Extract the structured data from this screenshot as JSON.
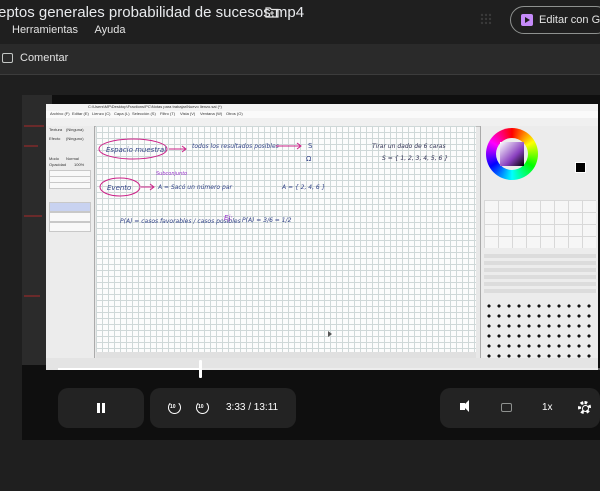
{
  "header": {
    "title": "eptos generales probabilidad de sucesos.mp4",
    "menu": [
      "Herramientas",
      "Ayuda"
    ],
    "edit_button": "Editar con Go"
  },
  "comment_bar": {
    "label": "Comentar"
  },
  "video": {
    "app_window_title": "C:\\Users\\MP\\Desktop\\Fractions\\PC\\Notas para trabajar\\Nuevo lienzo.sai (*)",
    "app_menu": [
      "Archivo (F)",
      "Editar (E)",
      "Lienzo (C)",
      "Capa (L)",
      "Selección (S)",
      "Filtro (T)",
      "Vista (V)",
      "Ventana (W)",
      "Otros (O)"
    ],
    "left_panel": {
      "labels": [
        "Textura",
        "Efecto",
        "Modo",
        "Opacidad"
      ],
      "values": [
        "(Ninguna)",
        "(Ninguno)",
        "Normal",
        "100%"
      ]
    },
    "whiteboard": {
      "line1_left": "Espacio muestral",
      "line1_mid": "todos los resultados posibles",
      "line1_s": "S",
      "line1_omega": "Ω",
      "line1_right": "Tirar un dado de 6 caras",
      "line1_set": "S = { 1, 2, 3, 4, 5, 6 }",
      "subset_note": "Subconjunto",
      "event": "Evento",
      "event_def": "A = Sacó un número par",
      "event_set": "A = { 2, 4, 6 }",
      "prob_def": "P(A) = casos favorables / casos posibles",
      "example_label": "Ej:",
      "example": "P(A) = 3/6 = 1/2"
    },
    "progress": 0.264
  },
  "controls": {
    "rewind_label": "10",
    "forward_label": "10",
    "current_time": "3:33",
    "duration": "/ 13:11",
    "speed": "1x"
  }
}
